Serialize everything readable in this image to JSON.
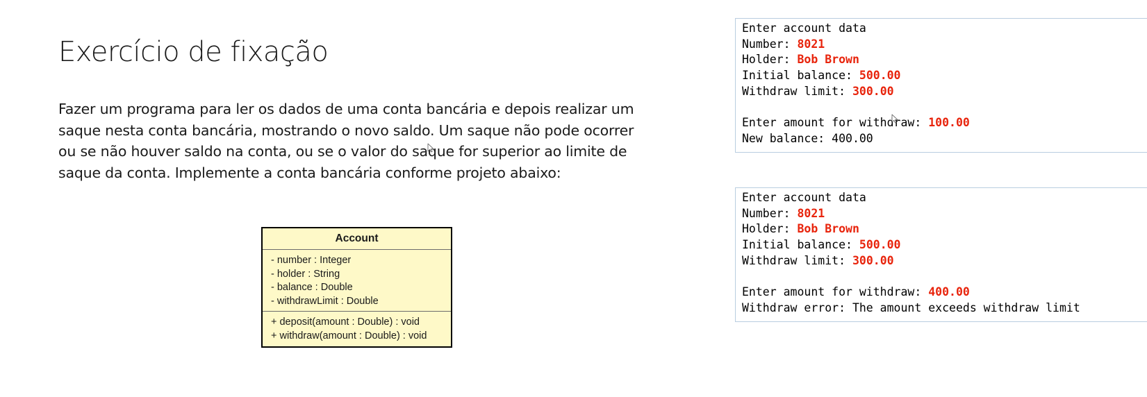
{
  "slide": {
    "title": "Exercício de fixação",
    "description_lines": [
      "Fazer um programa para ler os dados de uma conta bancária e depois realizar um",
      "saque nesta conta bancária, mostrando o novo saldo. Um saque não pode ocorrer",
      "ou se não houver saldo na conta, ou se o valor do saque for superior ao limite de",
      "saque da conta. Implemente a conta bancária conforme projeto abaixo:"
    ]
  },
  "uml": {
    "class_name": "Account",
    "attributes": [
      "- number : Integer",
      "- holder : String",
      "- balance : Double",
      "- withdrawLimit : Double"
    ],
    "operations": [
      "+ deposit(amount : Double) : void",
      "+ withdraw(amount : Double) : void"
    ],
    "fill_color": "#fef9c8",
    "border_color": "#000000"
  },
  "consoles": [
    {
      "lines": [
        {
          "prompt": "Enter account data",
          "input": ""
        },
        {
          "prompt": "Number: ",
          "input": "8021"
        },
        {
          "prompt": "Holder: ",
          "input": "Bob Brown"
        },
        {
          "prompt": "Initial balance: ",
          "input": "500.00"
        },
        {
          "prompt": "Withdraw limit: ",
          "input": "300.00"
        },
        {
          "prompt": "",
          "input": ""
        },
        {
          "prompt": "Enter amount for withdraw: ",
          "input": "100.00"
        },
        {
          "prompt": "New balance: 400.00",
          "input": ""
        }
      ]
    },
    {
      "lines": [
        {
          "prompt": "Enter account data",
          "input": ""
        },
        {
          "prompt": "Number: ",
          "input": "8021"
        },
        {
          "prompt": "Holder: ",
          "input": "Bob Brown"
        },
        {
          "prompt": "Initial balance: ",
          "input": "500.00"
        },
        {
          "prompt": "Withdraw limit: ",
          "input": "300.00"
        },
        {
          "prompt": "",
          "input": ""
        },
        {
          "prompt": "Enter amount for withdraw: ",
          "input": "400.00"
        },
        {
          "prompt": "Withdraw error: The amount exceeds withdraw limit",
          "input": ""
        }
      ]
    }
  ],
  "colors": {
    "input_highlight": "#e8240c",
    "console_border": "#b9cde0"
  },
  "icons": [
    "mouse-cursor-icon"
  ]
}
